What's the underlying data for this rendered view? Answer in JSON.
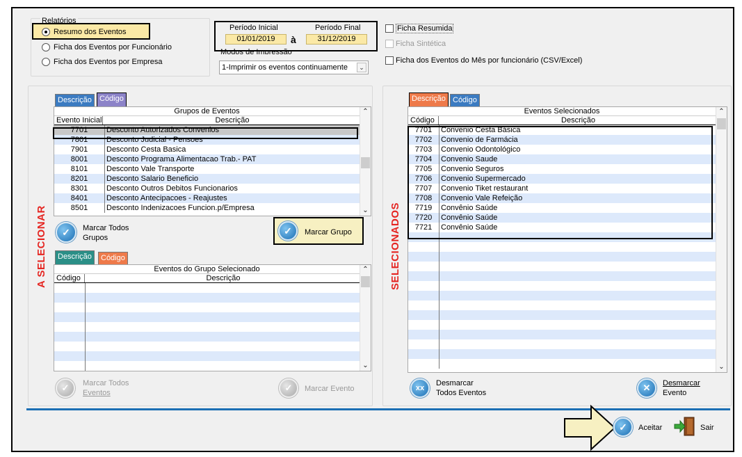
{
  "relatorios": {
    "title": "Relatórios",
    "options": [
      "Resumo dos Eventos",
      "Ficha dos Eventos por Funcionário",
      "Ficha dos Eventos por Empresa"
    ],
    "selected_index": 0
  },
  "periodo": {
    "inicial_label": "Período Inicial",
    "inicial_value": "01/01/2019",
    "separator": "à",
    "final_label": "Período Final",
    "final_value": "31/12/2019"
  },
  "modos": {
    "label": "Modos de Impressão",
    "value": "1-Imprimir os eventos continuamente"
  },
  "checks": {
    "ficha_resumida": "Ficha Resumida",
    "ficha_sintetica": "Ficha Sintética",
    "ficha_mes": "Ficha dos Eventos do Mês por funcionário  (CSV/Excel)"
  },
  "left": {
    "side_label": "A SELECIONAR",
    "tabs": [
      "Descrição",
      "Código"
    ],
    "grid_title": "Grupos de Eventos",
    "col1": "Evento Inicial",
    "col2": "Descrição",
    "rows": [
      {
        "code": "7701",
        "desc": "Desconto Autorizados Convenios"
      },
      {
        "code": "7801",
        "desc": "Desconto Judicial - Pensoes"
      },
      {
        "code": "7901",
        "desc": "Desconto Cesta Basica"
      },
      {
        "code": "8001",
        "desc": "Desconto Programa Alimentacao Trab.- PAT"
      },
      {
        "code": "8101",
        "desc": "Desconto Vale Transporte"
      },
      {
        "code": "8201",
        "desc": "Desconto Salario Beneficio"
      },
      {
        "code": "8301",
        "desc": "Desconto Outros Debitos Funcionarios"
      },
      {
        "code": "8401",
        "desc": "Desconto Antecipacoes - Reajustes"
      },
      {
        "code": "8501",
        "desc": "Desconto Indenizacoes Funcion.p/Empresa"
      }
    ],
    "marcar_todos_grupos_1": "Marcar Todos",
    "marcar_todos_grupos_2": "Grupos",
    "marcar_grupo": "Marcar Grupo",
    "tabs2": [
      "Descrição",
      "Código"
    ],
    "grid2_title": "Eventos do Grupo Selecionado",
    "grid2_col1": "Código",
    "grid2_col2": "Descrição",
    "marcar_todos_eventos_1": "Marcar Todos",
    "marcar_todos_eventos_2": "Eventos",
    "marcar_evento": "Marcar Evento"
  },
  "right": {
    "side_label": "SELECIONADOS",
    "tabs": [
      "Descrição",
      "Código"
    ],
    "grid_title": "Eventos Selecionados",
    "col1": "Código",
    "col2": "Descrição",
    "rows": [
      {
        "code": "7701",
        "desc": "Convenio Cesta Básica"
      },
      {
        "code": "7702",
        "desc": "Convenio de Farmácia"
      },
      {
        "code": "7703",
        "desc": "Convenio Odontológico"
      },
      {
        "code": "7704",
        "desc": "Convenio Saude"
      },
      {
        "code": "7705",
        "desc": "Convenio Seguros"
      },
      {
        "code": "7706",
        "desc": "Convenio Supermercado"
      },
      {
        "code": "7707",
        "desc": "Convenio Tiket restaurant"
      },
      {
        "code": "7708",
        "desc": "Convenio Vale Refeição"
      },
      {
        "code": "7719",
        "desc": "Convênio Saúde"
      },
      {
        "code": "7720",
        "desc": "Convênio Saúde"
      },
      {
        "code": "7721",
        "desc": "Convênio Saúde"
      }
    ],
    "desmarcar_todos_1": "Desmarcar",
    "desmarcar_todos_2": "Todos Eventos",
    "desmarcar_1": "Desmarcar",
    "desmarcar_2": "Evento"
  },
  "footer": {
    "aceitar": "Aceitar",
    "sair": "Sair"
  },
  "colors": {
    "accent_blue": "#1b6fb4",
    "side_label_red": "#e52521",
    "date_fill": "#fbe9a6",
    "row_alt": "#dde9fb",
    "arrow_fill": "#f7f0c2"
  }
}
